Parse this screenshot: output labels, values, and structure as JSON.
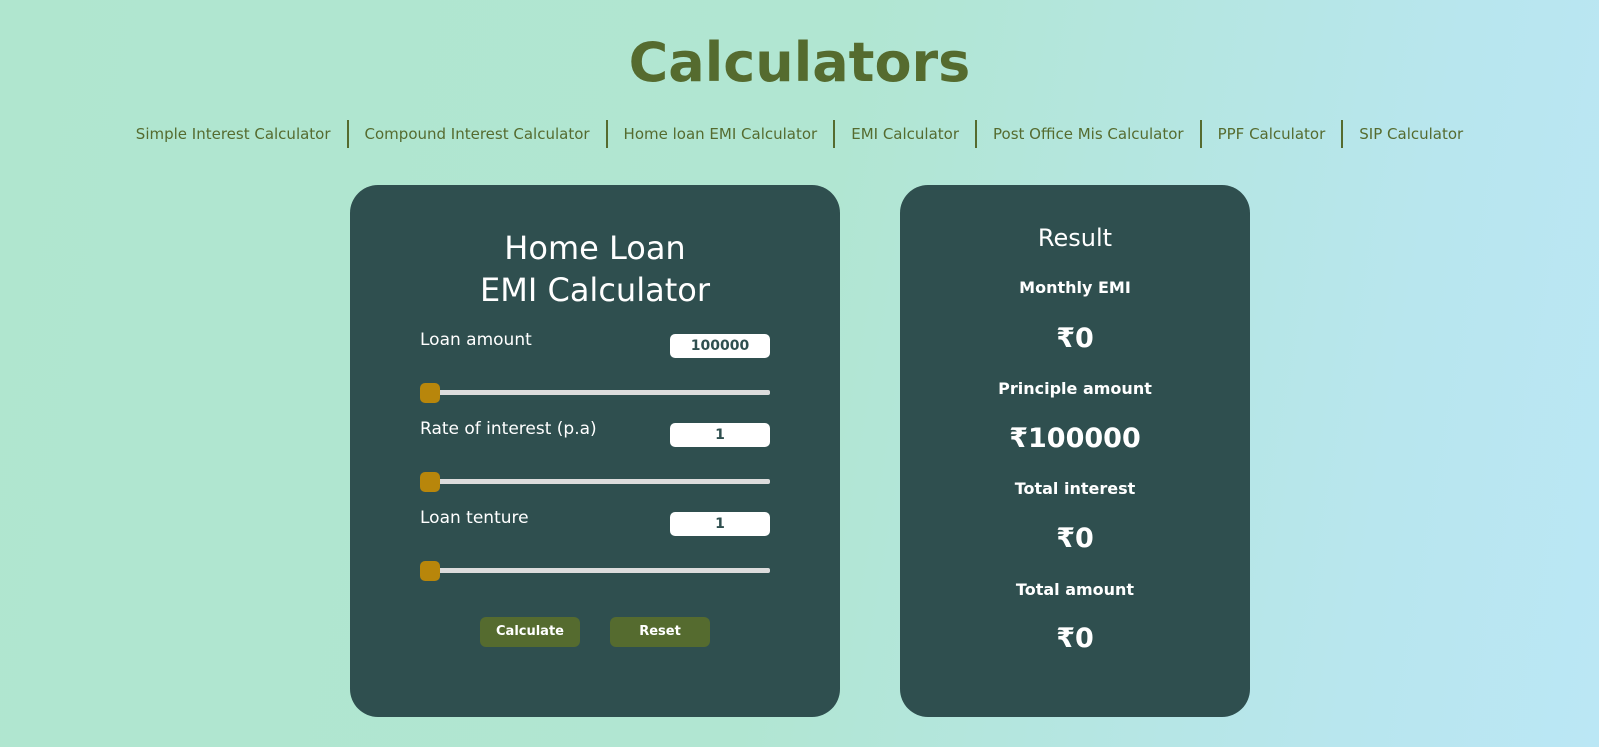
{
  "page": {
    "title": "Calculators"
  },
  "nav": {
    "items": [
      {
        "label": "Simple Interest Calculator"
      },
      {
        "label": "Compound Interest Calculator"
      },
      {
        "label": "Home loan EMI Calculator"
      },
      {
        "label": "EMI Calculator"
      },
      {
        "label": "Post Office Mis Calculator"
      },
      {
        "label": "PPF Calculator"
      },
      {
        "label": "SIP Calculator"
      }
    ]
  },
  "calculator": {
    "title_line1": "Home Loan",
    "title_line2": "EMI Calculator",
    "fields": [
      {
        "label": "Loan amount",
        "value": "100000",
        "slider_level": 0
      },
      {
        "label": "Rate of interest (p.a)",
        "value": "1",
        "slider_level": 0
      },
      {
        "label": "Loan tenture",
        "value": "1",
        "slider_level": 0
      }
    ],
    "calculate_label": "Calculate",
    "reset_label": "Reset"
  },
  "result": {
    "title": "Result",
    "items": [
      {
        "label": "Monthly EMI",
        "value": "₹0"
      },
      {
        "label": "Principle amount",
        "value": "₹100000"
      },
      {
        "label": "Total interest",
        "value": "₹0"
      },
      {
        "label": "Total amount",
        "value": "₹0"
      }
    ]
  },
  "colors": {
    "heading": "#556b2f",
    "card_background": "#2f4f4f",
    "button": "#556b2f",
    "slider_thumb": "#b8860b"
  }
}
